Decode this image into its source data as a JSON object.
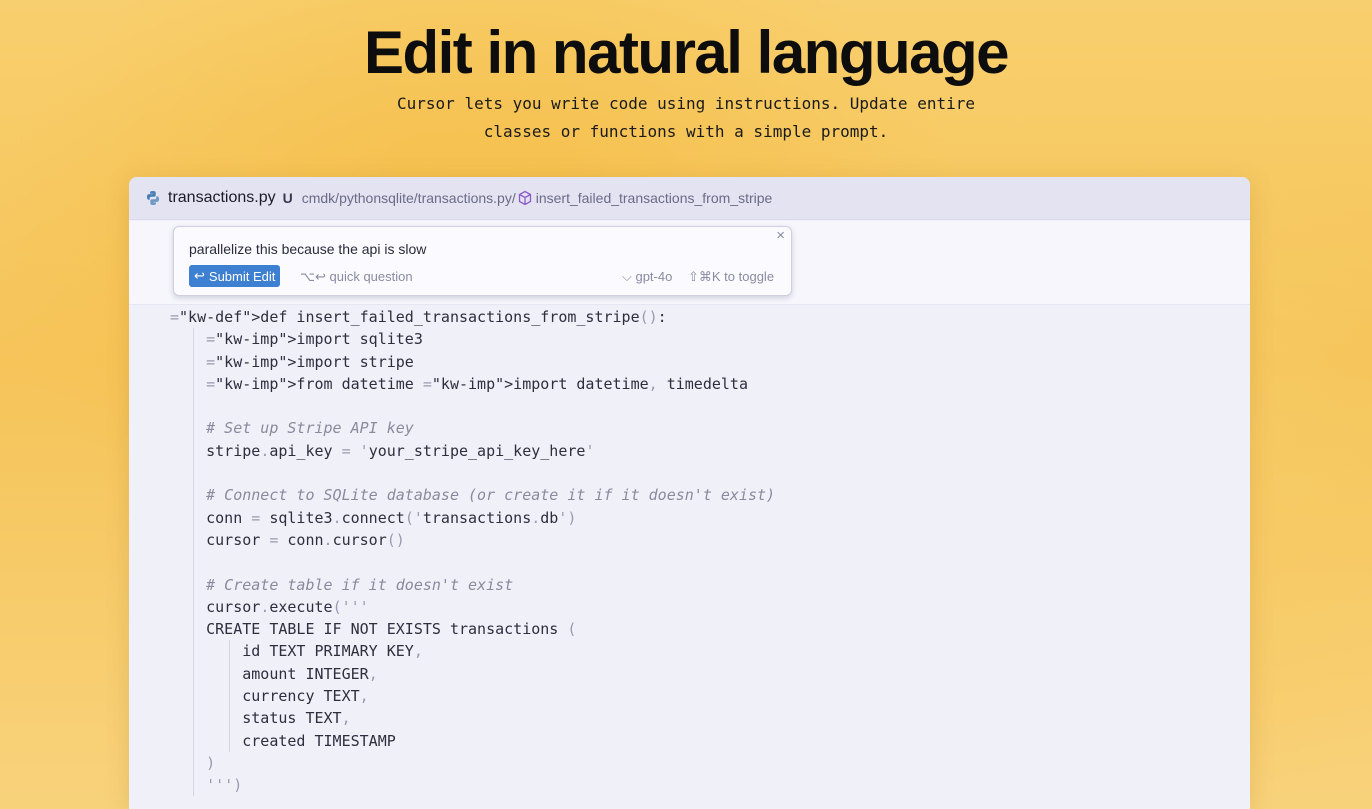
{
  "hero": {
    "title": "Edit in natural language",
    "subtitle_line1": "Cursor lets you write code using instructions. Update entire",
    "subtitle_line2": "classes or functions with a simple prompt."
  },
  "editor": {
    "tab": {
      "file_icon": "python-icon",
      "file_name": "transactions.py",
      "status": "U",
      "path": "cmdk/pythonsqlite/transactions.py/",
      "symbol_icon": "cube-icon",
      "symbol": "insert_failed_transactions_from_stripe"
    },
    "prompt": {
      "text": "parallelize this because the api is slow",
      "submit_label": "Submit Edit",
      "submit_icon": "↩",
      "quick_question": "⌥↩ quick question",
      "model": "⌵ gpt-4o",
      "toggle": "⇧⌘K to toggle",
      "close_icon": "×"
    },
    "code_lines": [
      "def insert_failed_transactions_from_stripe():",
      "    import sqlite3",
      "    import stripe",
      "    from datetime import datetime, timedelta",
      "",
      "    # Set up Stripe API key",
      "    stripe.api_key = 'your_stripe_api_key_here'",
      "",
      "    # Connect to SQLite database (or create it if it doesn't exist)",
      "    conn = sqlite3.connect('transactions.db')",
      "    cursor = conn.cursor()",
      "",
      "    # Create table if it doesn't exist",
      "    cursor.execute('''",
      "    CREATE TABLE IF NOT EXISTS transactions (",
      "        id TEXT PRIMARY KEY,",
      "        amount INTEGER,",
      "        currency TEXT,",
      "        status TEXT,",
      "        created TIMESTAMP",
      "    )",
      "    ''')"
    ]
  },
  "colors": {
    "accent_button": "#3d7fd0",
    "keyword_def": "#3a6fbf",
    "keyword_import": "#c0392b",
    "comment": "#8a8a9e"
  }
}
